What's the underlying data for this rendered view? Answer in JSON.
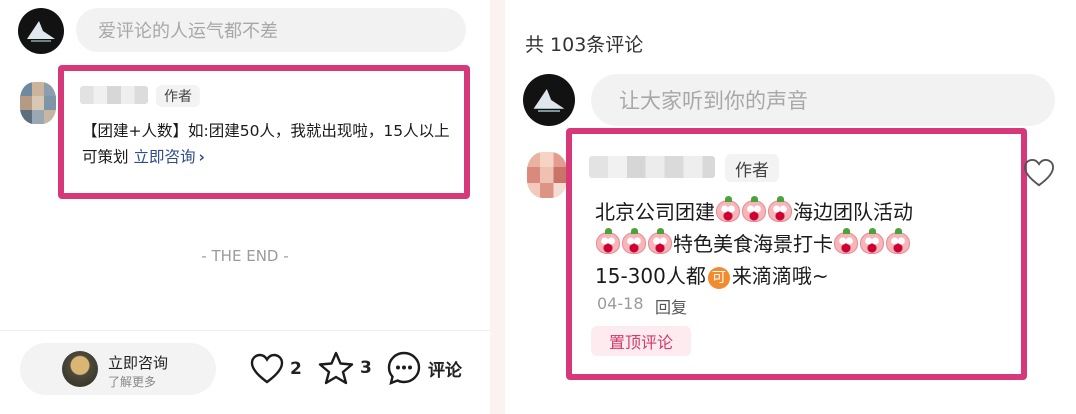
{
  "left": {
    "input_placeholder": "爱评论的人运气都不差",
    "comment": {
      "author_tag": "作者",
      "text": "【团建+人数】如:团建50人，我就出现啦，15人以上可策划",
      "link_label": "立即咨询",
      "link_chevron": "›"
    },
    "end_label": "- THE END -",
    "bottom_bar": {
      "consult_title": "立即咨询",
      "consult_subtitle": "了解更多",
      "like_count": "2",
      "star_count": "3",
      "comment_label": "评论"
    }
  },
  "right": {
    "comment_count": "共 103条评论",
    "input_placeholder": "让大家听到你的声音",
    "comment": {
      "author_tag": "作者",
      "line1_a": "北京公司团建",
      "line1_b": "海边团队活动",
      "line2_a": "特色美食海景打卡",
      "line3_a": "15-300人都",
      "line3_badge": "可",
      "line3_b": "来滴滴哦~",
      "date": "04-18",
      "reply_label": "回复",
      "pinned_label": "置顶评论"
    }
  },
  "colors": {
    "highlight": "#d63879",
    "link": "#2f4d87",
    "pinned_text": "#d23a6a"
  }
}
